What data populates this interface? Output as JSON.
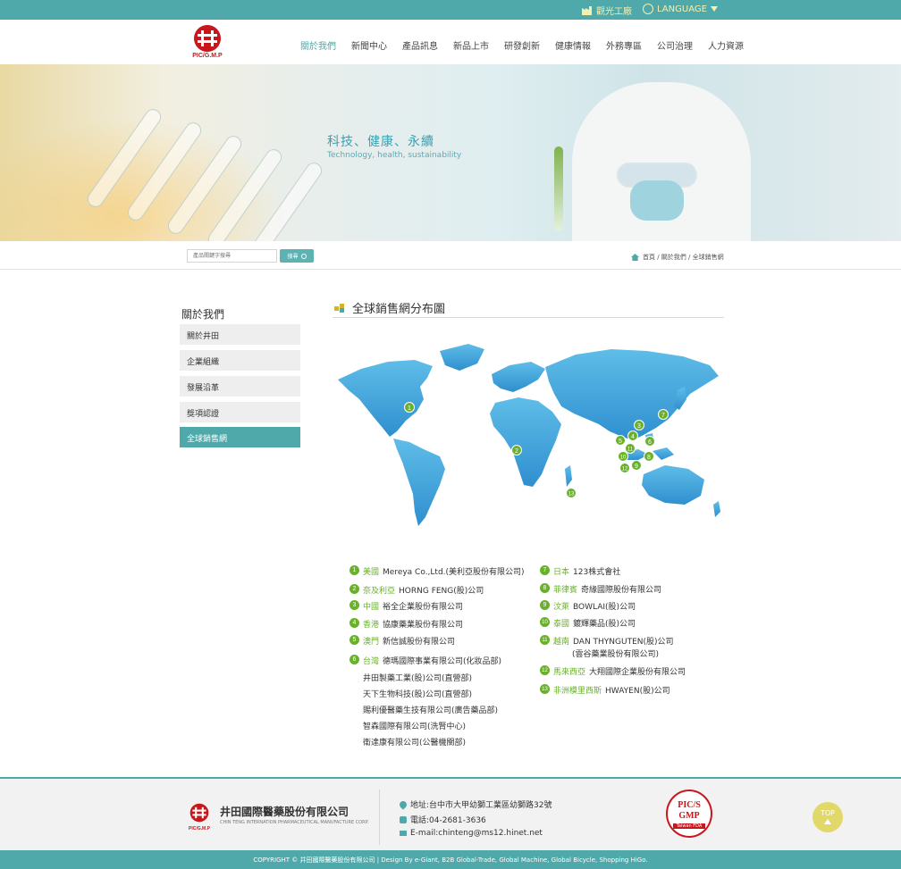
{
  "topbar": {
    "tour_label": "觀光工廠",
    "language_label": "LANGUAGE"
  },
  "logo": {
    "text": "PIC/G.M.P"
  },
  "nav": [
    "關於我們",
    "新聞中心",
    "產品訊息",
    "新品上市",
    "研發創新",
    "健康情報",
    "外務專區",
    "公司治理",
    "人力資源"
  ],
  "banner": {
    "slogan": "科技、健康、永續",
    "slogan_en": "Technology, health, sustainability"
  },
  "search": {
    "placeholder": "產品關鍵字搜尋",
    "button_label": "搜尋"
  },
  "breadcrumb": "首頁 / 關於我們 / 全球銷售網",
  "sidebar": {
    "title": "關於我們",
    "items": [
      "關於井田",
      "企業組織",
      "發展沿革",
      "獎項認證",
      "全球銷售網"
    ]
  },
  "content": {
    "title": "全球銷售網分布圖"
  },
  "distributors_left": [
    {
      "num": "1",
      "country": "美國",
      "company": "Mereya Co.,Ltd.(美利亞股份有限公司)"
    },
    {
      "num": "2",
      "country": "奈及利亞",
      "company": "HORNG FENG(股)公司"
    },
    {
      "num": "3",
      "country": "中國",
      "company": "裕全企業股份有限公司"
    },
    {
      "num": "4",
      "country": "香港",
      "company": "協康藥業股份有限公司"
    },
    {
      "num": "5",
      "country": "澳門",
      "company": "新信誠股份有限公司"
    },
    {
      "num": "6",
      "country": "台灣",
      "company": "德瑪國際事業有限公司(化妝品部)"
    }
  ],
  "taiwan_more": [
    "井田製藥工業(股)公司(直營部)",
    "天下生物科技(股)公司(直營部)",
    "賜利優醫藥生技有限公司(廣告藥品部)",
    "智森國際有限公司(洗腎中心)",
    "衛達康有限公司(公醫機關部)"
  ],
  "distributors_right": [
    {
      "num": "7",
      "country": "日本",
      "company": "123株式會社"
    },
    {
      "num": "8",
      "country": "菲律賓",
      "company": "奇緣國際股份有限公司"
    },
    {
      "num": "9",
      "country": "汶萊",
      "company": "BOWLAI(股)公司"
    },
    {
      "num": "10",
      "country": "泰國",
      "company": "鍍輝藥品(股)公司"
    },
    {
      "num": "11",
      "country": "越南",
      "company": "DAN THYNGUTEN(股)公司",
      "company2": "(雲谷藥業股份有限公司)"
    },
    {
      "num": "12",
      "country": "馬來西亞",
      "company": "大翔國際企業股份有限公司"
    },
    {
      "num": "13",
      "country": "非洲模里西斯",
      "company": "HWAYEN(股)公司"
    }
  ],
  "footer": {
    "logo_text": "PIC/G.M.P",
    "company": "井田國際醫藥股份有限公司",
    "company_en": "CHIN TENG INTERNATION PHARMACEUTICAL MANUFACTURE CORP.",
    "address": "地址:台中市大甲幼獅工業區幼獅路32號",
    "phone": "電話:04-2681-3636",
    "email": "E-mail:chinteng@ms12.hinet.net",
    "badge_line1": "PIC/S",
    "badge_line2": "GMP",
    "badge_line3": "Taiwan FDA",
    "top_label": "TOP",
    "copyright": "COPYRIGHT © 井田國際醫藥股份有限公司 | Design By e-Giant, B2B Global-Trade, Global Machine, Global Bicycle, Shopping HiGo."
  },
  "colors": {
    "teal": "#4fa8a9",
    "green": "#6ab12b",
    "map_blue": "#3fa2dc",
    "brand_red": "#c8161d"
  }
}
